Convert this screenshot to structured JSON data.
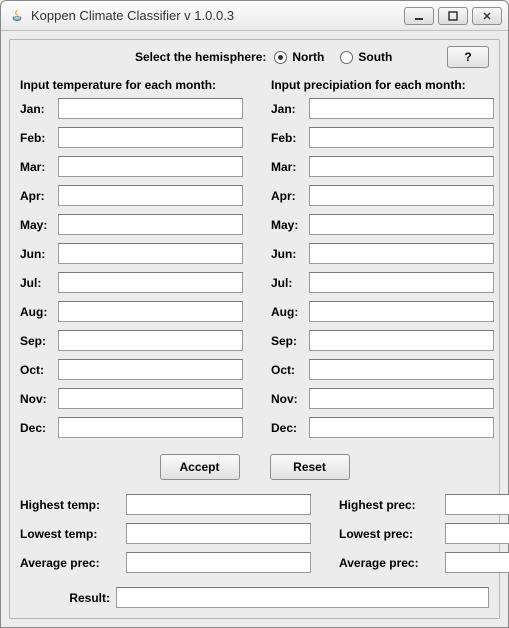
{
  "window": {
    "title": "Koppen Climate Classifier v 1.0.0.3"
  },
  "header": {
    "prompt": "Select the hemisphere:",
    "north_label": "North",
    "south_label": "South",
    "selected": "north",
    "help_label": "?"
  },
  "temp": {
    "heading": "Input temperature for each month:",
    "months": {
      "jan": {
        "label": "Jan:",
        "value": ""
      },
      "feb": {
        "label": "Feb:",
        "value": ""
      },
      "mar": {
        "label": "Mar:",
        "value": ""
      },
      "apr": {
        "label": "Apr:",
        "value": ""
      },
      "may": {
        "label": "May:",
        "value": ""
      },
      "jun": {
        "label": "Jun:",
        "value": ""
      },
      "jul": {
        "label": "Jul:",
        "value": ""
      },
      "aug": {
        "label": "Aug:",
        "value": ""
      },
      "sep": {
        "label": "Sep:",
        "value": ""
      },
      "oct": {
        "label": "Oct:",
        "value": ""
      },
      "nov": {
        "label": "Nov:",
        "value": ""
      },
      "dec": {
        "label": "Dec:",
        "value": ""
      }
    }
  },
  "prec": {
    "heading": "Input precipiation for each month:",
    "months": {
      "jan": {
        "label": "Jan:",
        "value": ""
      },
      "feb": {
        "label": "Feb:",
        "value": ""
      },
      "mar": {
        "label": "Mar:",
        "value": ""
      },
      "apr": {
        "label": "Apr:",
        "value": ""
      },
      "may": {
        "label": "May:",
        "value": ""
      },
      "jun": {
        "label": "Jun:",
        "value": ""
      },
      "jul": {
        "label": "Jul:",
        "value": ""
      },
      "aug": {
        "label": "Aug:",
        "value": ""
      },
      "sep": {
        "label": "Sep:",
        "value": ""
      },
      "oct": {
        "label": "Oct:",
        "value": ""
      },
      "nov": {
        "label": "Nov:",
        "value": ""
      },
      "dec": {
        "label": "Dec:",
        "value": ""
      }
    }
  },
  "buttons": {
    "accept": "Accept",
    "reset": "Reset"
  },
  "stats": {
    "left": {
      "highest_temp": {
        "label": "Highest temp:",
        "value": ""
      },
      "lowest_temp": {
        "label": "Lowest temp:",
        "value": ""
      },
      "average_prec": {
        "label": "Average prec:",
        "value": ""
      }
    },
    "right": {
      "highest_prec": {
        "label": "Highest prec:",
        "value": ""
      },
      "lowest_prec": {
        "label": "Lowest prec:",
        "value": ""
      },
      "average_prec": {
        "label": "Average prec:",
        "value": ""
      }
    }
  },
  "result": {
    "label": "Result:",
    "value": ""
  }
}
